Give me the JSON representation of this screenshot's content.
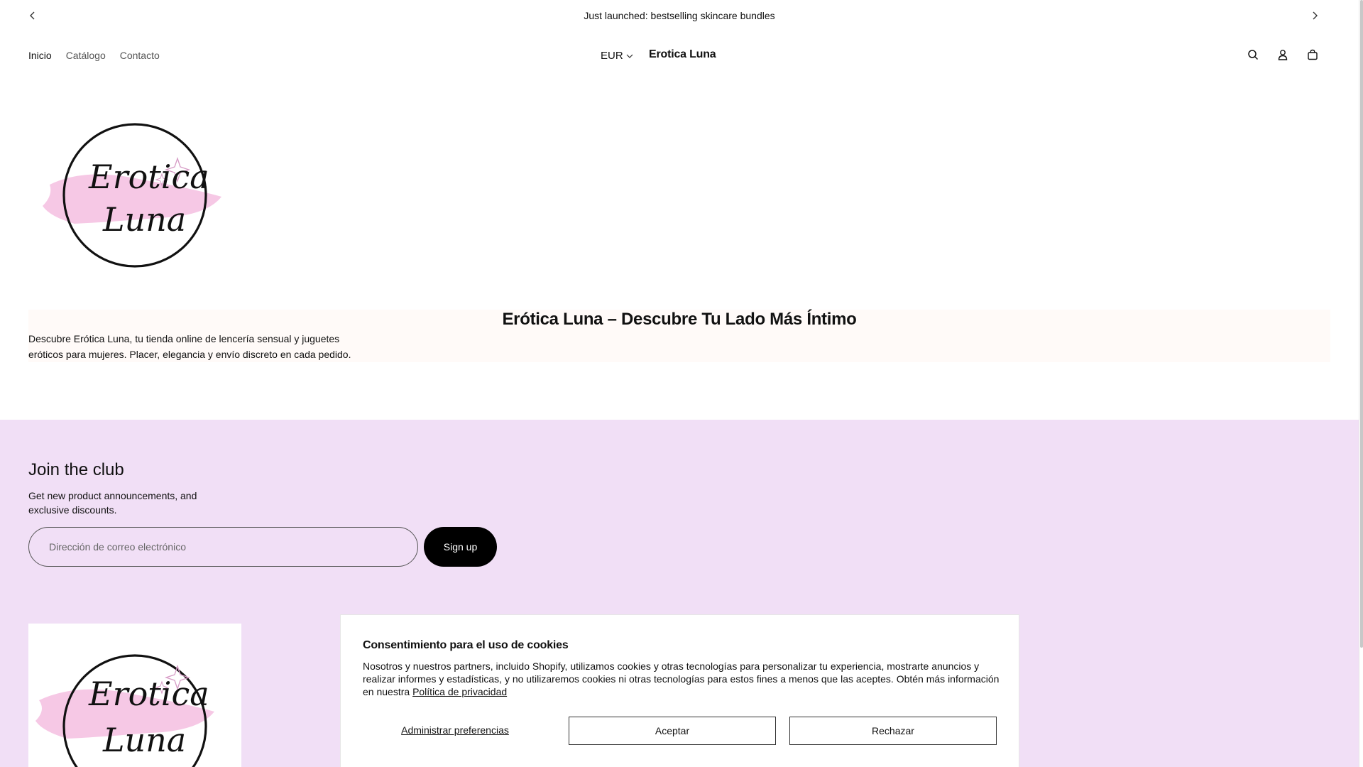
{
  "announcement": {
    "text": "Just launched: bestselling skincare bundles"
  },
  "header": {
    "nav": [
      "Inicio",
      "Catálogo",
      "Contacto"
    ],
    "currency": "EUR",
    "brand": "Erotica Luna",
    "icons": [
      "search-icon",
      "account-icon",
      "cart-icon"
    ]
  },
  "logo": {
    "line1": "Erotica",
    "line2": "Luna",
    "accent_color": "#f3b6dc"
  },
  "hero": {
    "title": "Erótica Luna – Descubre Tu Lado Más Íntimo",
    "description": "Descubre Erótica Luna, tu tienda online de lencería sensual y juguetes eróticos para mujeres. Placer, elegancia y envío discreto en cada pedido."
  },
  "newsletter": {
    "title": "Join the club",
    "description": "Get new product announcements, and exclusive discounts.",
    "email_placeholder": "Dirección de correo electrónico",
    "button": "Sign up",
    "background": "#f1dff6"
  },
  "cookie": {
    "title": "Consentimiento para el uso de cookies",
    "text": "Nosotros y nuestros partners, incluido Shopify, utilizamos cookies y otras tecnologías para personalizar tu experiencia, mostrarte anuncios y realizar informes y estadísticas, y no utilizaremos cookies ni otras tecnologías para estos fines a menos que las aceptes. Obtén más información en nuestra",
    "link": "Política de privacidad",
    "manage": "Administrar preferencias",
    "accept": "Aceptar",
    "reject": "Rechazar"
  }
}
